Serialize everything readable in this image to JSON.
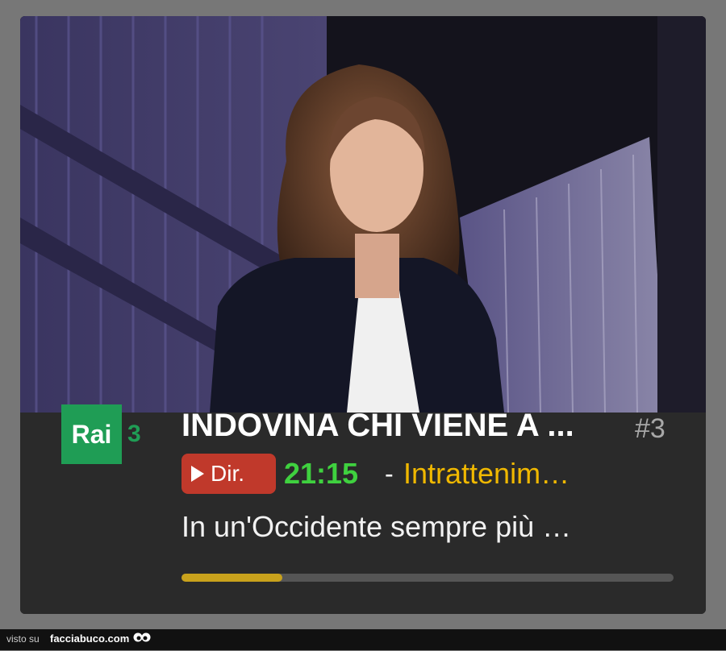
{
  "program": {
    "channel": {
      "name": "Rai",
      "number": "3",
      "brand_color": "#1f9d55"
    },
    "title": "INDOVINA CHI VIENE A ...",
    "episode": "#3",
    "live_button_label": "Dir.",
    "time": "21:15",
    "separator": "-",
    "genre": "Intrattenim…",
    "description": "In un'Occidente sempre più …",
    "progress": 0.205
  },
  "footer": {
    "prefix": "visto su",
    "site": "facciabuco.com"
  },
  "colors": {
    "live_red": "#c0392b",
    "time_green": "#3fd13f",
    "genre_yellow": "#f0b800",
    "progress_gold": "#c9a21c"
  }
}
